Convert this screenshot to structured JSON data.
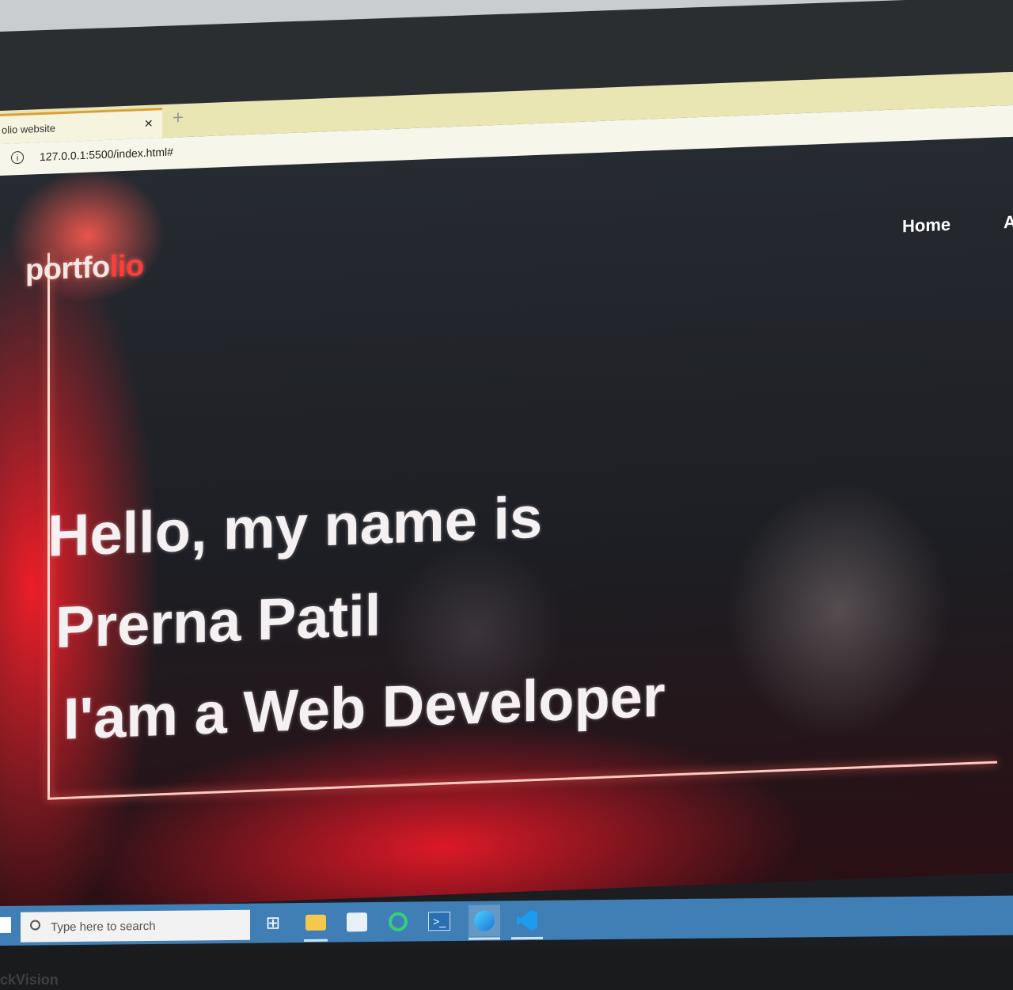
{
  "browser": {
    "tab_title": "olio website",
    "tab_close": "×",
    "new_tab": "+",
    "url": "127.0.0.1:5500/index.html#"
  },
  "page": {
    "logo_main": "portfo",
    "logo_accent": "lio",
    "nav": {
      "home": "Home",
      "next": "A"
    },
    "hero": {
      "line1": "Hello, my name is",
      "line2": "Prerna Patil",
      "line3": "I'am a Web Developer"
    }
  },
  "taskbar": {
    "search_placeholder": "Type here to search",
    "icons": [
      "task-view-icon",
      "file-explorer-icon",
      "store-icon",
      "ring-app-icon",
      "powershell-icon",
      "edge-icon",
      "vscode-icon"
    ]
  },
  "monitor": {
    "brand_text": "ckVision"
  },
  "colors": {
    "accent": "#ff3d3d",
    "taskbar": "#3f7fb6",
    "tabstrip": "#eae6b4"
  }
}
